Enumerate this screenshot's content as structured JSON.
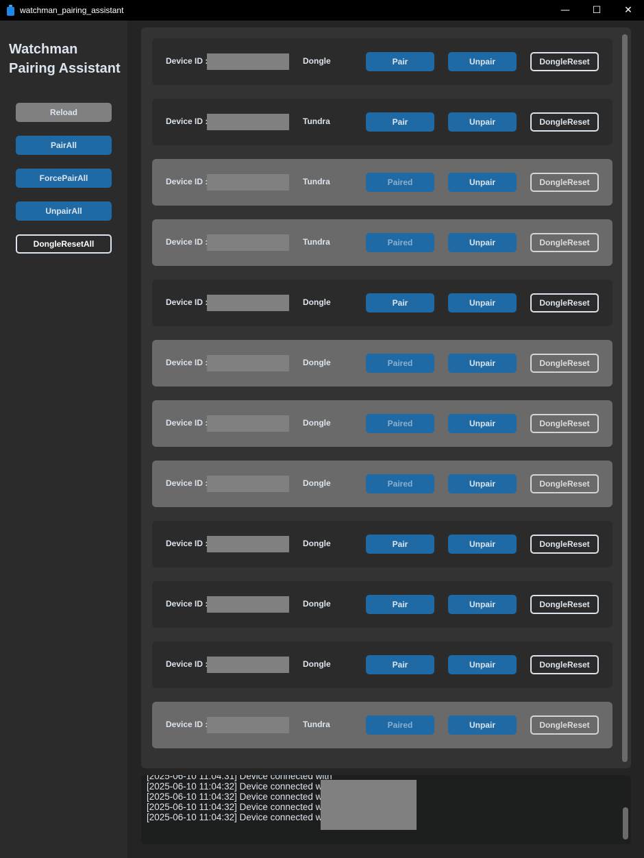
{
  "window": {
    "title": "watchman_pairing_assistant",
    "controls": [
      "—",
      "☐",
      "✕"
    ]
  },
  "sidebar": {
    "heading_line1": "Watchman",
    "heading_line2": "Pairing Assistant",
    "buttons": [
      {
        "label": "Reload",
        "style": "gray"
      },
      {
        "label": "PairAll",
        "style": "blue"
      },
      {
        "label": "ForcePairAll",
        "style": "blue"
      },
      {
        "label": "UnpairAll",
        "style": "blue"
      },
      {
        "label": "DongleResetAll",
        "style": "outline"
      }
    ]
  },
  "devices": [
    {
      "label": "Device ID :",
      "type": "Dongle",
      "pair": "Pair",
      "unpair": "Unpair",
      "reset": "DongleReset",
      "paired": false
    },
    {
      "label": "Device ID :",
      "type": "Tundra",
      "pair": "Pair",
      "unpair": "Unpair",
      "reset": "DongleReset",
      "paired": false
    },
    {
      "label": "Device ID :",
      "type": "Tundra",
      "pair": "Paired",
      "unpair": "Unpair",
      "reset": "DongleReset",
      "paired": true
    },
    {
      "label": "Device ID :",
      "type": "Tundra",
      "pair": "Paired",
      "unpair": "Unpair",
      "reset": "DongleReset",
      "paired": true
    },
    {
      "label": "Device ID :",
      "type": "Dongle",
      "pair": "Pair",
      "unpair": "Unpair",
      "reset": "DongleReset",
      "paired": false
    },
    {
      "label": "Device ID :",
      "type": "Dongle",
      "pair": "Paired",
      "unpair": "Unpair",
      "reset": "DongleReset",
      "paired": true
    },
    {
      "label": "Device ID :",
      "type": "Dongle",
      "pair": "Paired",
      "unpair": "Unpair",
      "reset": "DongleReset",
      "paired": true
    },
    {
      "label": "Device ID :",
      "type": "Dongle",
      "pair": "Paired",
      "unpair": "Unpair",
      "reset": "DongleReset",
      "paired": true
    },
    {
      "label": "Device ID :",
      "type": "Dongle",
      "pair": "Pair",
      "unpair": "Unpair",
      "reset": "DongleReset",
      "paired": false
    },
    {
      "label": "Device ID :",
      "type": "Dongle",
      "pair": "Pair",
      "unpair": "Unpair",
      "reset": "DongleReset",
      "paired": false
    },
    {
      "label": "Device ID :",
      "type": "Dongle",
      "pair": "Pair",
      "unpair": "Unpair",
      "reset": "DongleReset",
      "paired": false
    },
    {
      "label": "Device ID :",
      "type": "Tundra",
      "pair": "Paired",
      "unpair": "Unpair",
      "reset": "DongleReset",
      "paired": true
    }
  ],
  "log": {
    "lines": [
      "[2025-06-10 11:04:31] Device connected with",
      "[2025-06-10 11:04:32] Device connected with",
      "[2025-06-10 11:04:32] Device connected with",
      "[2025-06-10 11:04:32] Device connected with",
      "[2025-06-10 11:04:32] Device connected with"
    ]
  },
  "colors": {
    "accent_blue": "#1f6aa5",
    "row_normal": "#2b2b2b",
    "row_paired": "#6a6a6a",
    "redaction": "#808080"
  }
}
